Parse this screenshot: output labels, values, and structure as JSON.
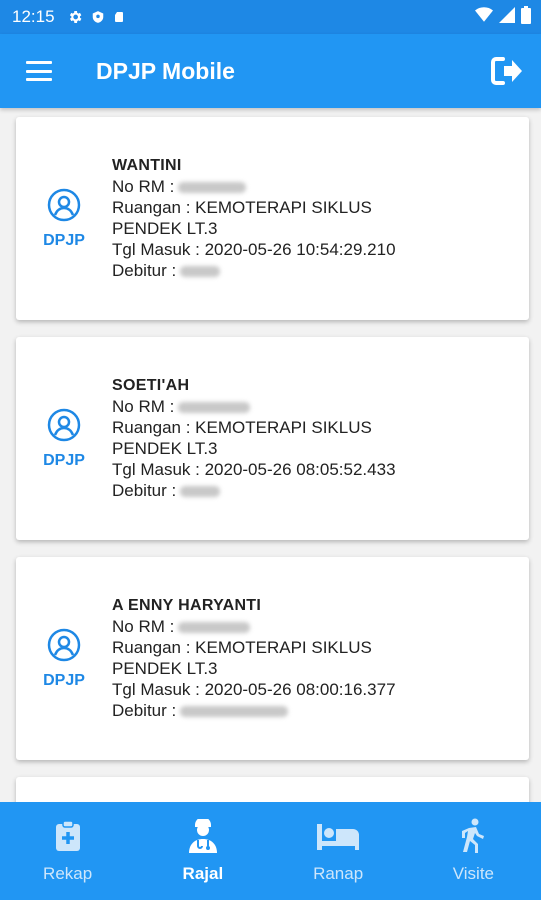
{
  "status_bar": {
    "time": "12:15"
  },
  "app_bar": {
    "title": "DPJP Mobile"
  },
  "patients": [
    {
      "badge": "DPJP",
      "name": "WANTINI",
      "no_rm_label": "No RM :",
      "ruangan": "Ruangan : KEMOTERAPI SIKLUS PENDEK LT.3",
      "tgl_masuk": "Tgl Masuk : 2020-05-26 10:54:29.210",
      "debitur_label": "Debitur :"
    },
    {
      "badge": "DPJP",
      "name": "SOETI'AH",
      "no_rm_label": "No RM :",
      "ruangan": "Ruangan : KEMOTERAPI SIKLUS PENDEK LT.3",
      "tgl_masuk": "Tgl Masuk : 2020-05-26 08:05:52.433",
      "debitur_label": "Debitur :"
    },
    {
      "badge": "DPJP",
      "name": "A ENNY HARYANTI",
      "no_rm_label": "No RM :",
      "ruangan": "Ruangan : KEMOTERAPI SIKLUS PENDEK LT.3",
      "tgl_masuk": "Tgl Masuk : 2020-05-26 08:00:16.377",
      "debitur_label": "Debitur :"
    }
  ],
  "bottom_nav": {
    "items": [
      {
        "label": "Rekap",
        "icon": "clipboard-plus-icon"
      },
      {
        "label": "Rajal",
        "icon": "doctor-icon"
      },
      {
        "label": "Ranap",
        "icon": "bed-icon"
      },
      {
        "label": "Visite",
        "icon": "walking-icon"
      }
    ],
    "active": "Rajal"
  },
  "colors": {
    "primary": "#2196f3",
    "status_bar": "#1e88e5",
    "accent_text": "#1e88e5",
    "inactive_nav": "#cde6fb"
  }
}
